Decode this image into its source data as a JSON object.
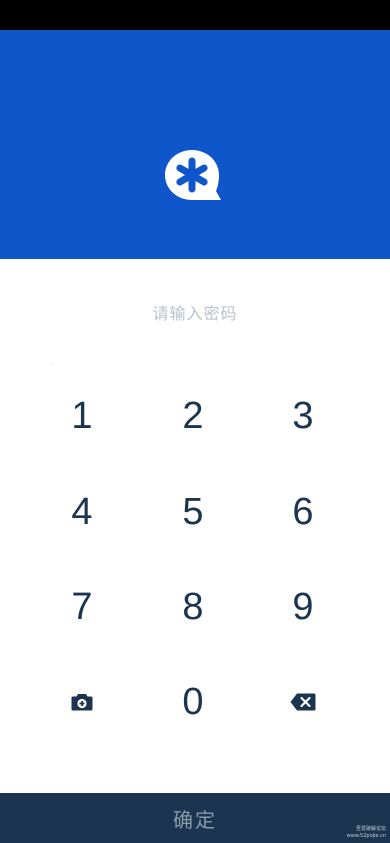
{
  "header": {
    "logo_icon": "asterisk-chat-bubble-icon",
    "background_color": "#0e56c9"
  },
  "prompt": {
    "text": "请输入密码"
  },
  "keypad": {
    "keys": [
      "1",
      "2",
      "3",
      "4",
      "5",
      "6",
      "7",
      "8",
      "9",
      "0"
    ],
    "left_icon": "camera-icon",
    "right_icon": "backspace-icon"
  },
  "confirm": {
    "label": "确定"
  },
  "watermark": {
    "line1": "吾爱破解论坛",
    "line2": "www.52pojie.cn"
  },
  "colors": {
    "key_text": "#1b3550",
    "confirm_bg": "#1b3550",
    "confirm_text": "#8a9aaa",
    "prompt_text": "#b8c3cc"
  }
}
